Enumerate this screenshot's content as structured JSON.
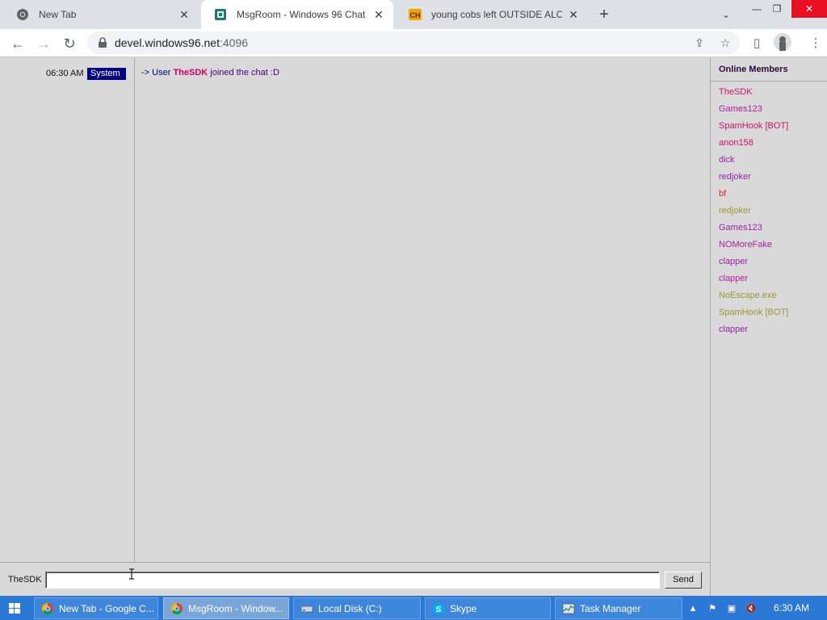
{
  "browser": {
    "tabs": [
      {
        "title": "New Tab",
        "icon": "chrome-icon",
        "active": false
      },
      {
        "title": "MsgRoom - Windows 96 Chat",
        "icon": "msgroom-icon",
        "active": true
      },
      {
        "title": "young cobs left OUTSIDE ALONE",
        "icon": "ch-icon",
        "active": false
      }
    ],
    "url_host": "devel.windows96.net",
    "url_port": ":4096"
  },
  "chat": {
    "messages": [
      {
        "time": "06:30 AM",
        "badge": "System",
        "prefix": "-> User ",
        "user": "TheSDK",
        "text": " joined the chat :D"
      }
    ],
    "members_title": "Online Members",
    "members": [
      {
        "name": "TheSDK",
        "color": "#cc1166"
      },
      {
        "name": "Games123",
        "color": "#aa2299"
      },
      {
        "name": "SpamHook [BOT]",
        "color": "#cc1166"
      },
      {
        "name": "anon158",
        "color": "#cc1166"
      },
      {
        "name": "dick",
        "color": "#9922aa"
      },
      {
        "name": "redjoker",
        "color": "#9922aa"
      },
      {
        "name": "bf",
        "color": "#dd2244"
      },
      {
        "name": "redjoker",
        "color": "#999933"
      },
      {
        "name": "Games123",
        "color": "#9922aa"
      },
      {
        "name": "NOMoreFake",
        "color": "#aa2299"
      },
      {
        "name": "clapper",
        "color": "#9922aa"
      },
      {
        "name": "clapper",
        "color": "#aa2299"
      },
      {
        "name": "NoEscape.exe",
        "color": "#999933"
      },
      {
        "name": "SpamHook [BOT]",
        "color": "#999933"
      },
      {
        "name": "clapper",
        "color": "#9922aa"
      }
    ],
    "input_username": "TheSDK",
    "input_value": "",
    "send_label": "Send"
  },
  "taskbar": {
    "items": [
      {
        "label": "New Tab - Google C...",
        "icon": "chrome-icon",
        "active": false
      },
      {
        "label": "MsgRoom - Window...",
        "icon": "chrome-icon",
        "active": true
      },
      {
        "label": "Local Disk (C:)",
        "icon": "drive-icon",
        "active": false
      },
      {
        "label": "Skype",
        "icon": "skype-icon",
        "active": false
      },
      {
        "label": "Task Manager",
        "icon": "task-manager-icon",
        "active": false
      }
    ],
    "clock": "6:30 AM"
  }
}
